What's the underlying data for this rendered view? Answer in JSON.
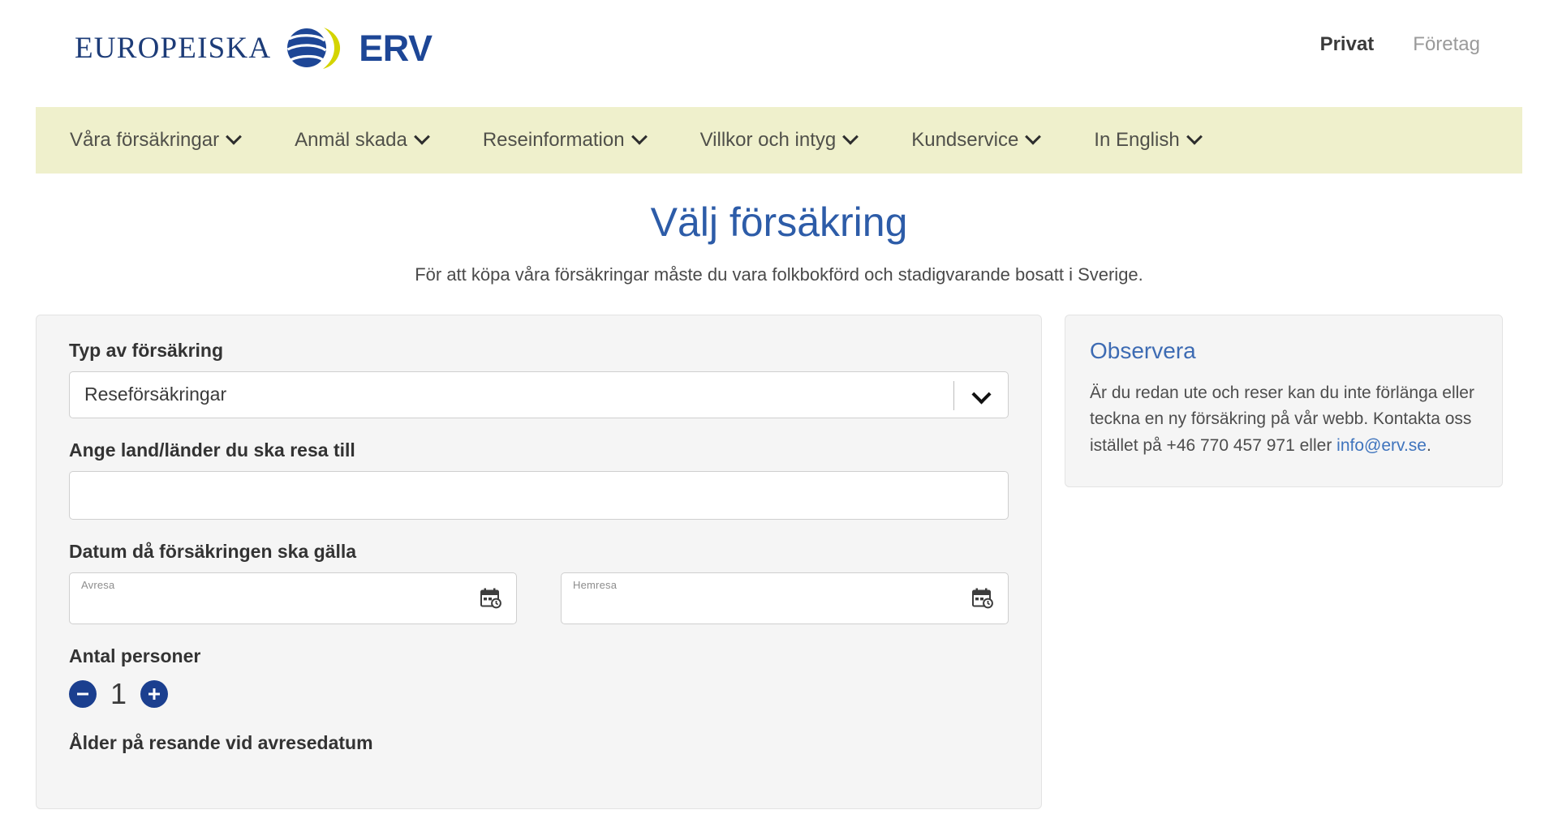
{
  "header": {
    "brand_word": "EUROPEISKA",
    "brand_erv": "ERV",
    "logo_icon": "erv-globe-logo",
    "top_nav": [
      {
        "label": "Privat",
        "active": true
      },
      {
        "label": "Företag",
        "active": false
      }
    ]
  },
  "main_nav": {
    "items": [
      {
        "label": "Våra försäkringar",
        "has_dropdown": true
      },
      {
        "label": "Anmäl skada",
        "has_dropdown": true
      },
      {
        "label": "Reseinformation",
        "has_dropdown": true
      },
      {
        "label": "Villkor och intyg",
        "has_dropdown": true
      },
      {
        "label": "Kundservice",
        "has_dropdown": true
      },
      {
        "label": "In English",
        "has_dropdown": true
      }
    ],
    "background_color": "#eff0cc"
  },
  "page": {
    "title": "Välj försäkring",
    "subtitle": "För att köpa våra försäkringar måste du vara folkbokförd och stadigvarande bosatt i Sverige.",
    "title_color": "#2d5ca8"
  },
  "form": {
    "insurance_type": {
      "label": "Typ av försäkring",
      "selected": "Reseförsäkringar",
      "chevron_icon": "chevron-down-icon"
    },
    "country": {
      "label": "Ange land/länder du ska resa till",
      "value": "",
      "placeholder": ""
    },
    "dates": {
      "label": "Datum då försäkringen ska gälla",
      "departure": {
        "float_label": "Avresa",
        "value": "",
        "icon": "calendar-icon"
      },
      "return": {
        "float_label": "Hemresa",
        "value": "",
        "icon": "calendar-icon"
      }
    },
    "persons": {
      "label": "Antal personer",
      "count": "1",
      "decrement_icon": "minus-circle-icon",
      "increment_icon": "plus-circle-icon",
      "button_color": "#1b3f8f"
    },
    "ages": {
      "label": "Ålder på resande vid avresedatum"
    }
  },
  "sidebar": {
    "title": "Observera",
    "body": "Är du redan ute och reser kan du inte förlänga eller teckna en ny försäkring på vår webb. Kontakta oss istället på +46 770 457 971 eller ",
    "link": "info@erv.se",
    "body_suffix": ".",
    "link_color": "#3f74bd"
  }
}
